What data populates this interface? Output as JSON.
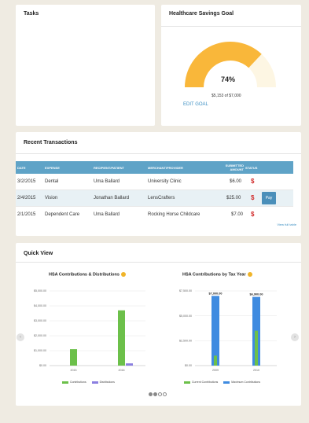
{
  "tasks": {
    "title": "Tasks"
  },
  "savings_goal": {
    "title": "Healthcare Savings Goal",
    "percent_text": "74%",
    "progress_fraction": 0.74,
    "amount_text": "$5,153 of $7,000",
    "edit_label": "EDIT GOAL"
  },
  "transactions": {
    "title": "Recent Transactions",
    "headers": {
      "date": "DATE",
      "expense": "EXPENSE",
      "recipient": "RECIPIENT/PATIENT",
      "merchant": "MERCHANT/PROVIDER",
      "amount_line1": "SUBMITTED",
      "amount_line2": "AMOUNT",
      "status": "STATUS"
    },
    "rows": [
      {
        "date": "3/2/2015",
        "expense": "Dental",
        "recipient": "Uma Ballard",
        "merchant": "University Clinic",
        "amount": "$6.00",
        "status": "$"
      },
      {
        "date": "2/4/2015",
        "expense": "Vision",
        "recipient": "Jonathan Ballard",
        "merchant": "LensCrafters",
        "amount": "$25.00",
        "status": "$",
        "action": "Pay"
      },
      {
        "date": "2/1/2015",
        "expense": "Dependent Care",
        "recipient": "Uma Ballard",
        "merchant": "Rocking Horse Childcare",
        "amount": "$7.00",
        "status": "$"
      }
    ],
    "view_all_label": "View full table"
  },
  "quick_view": {
    "title": "Quick View",
    "left_arrow": "‹",
    "right_arrow": "›"
  },
  "chart_data": [
    {
      "type": "bar",
      "title": "HSA Contributions & Distributions",
      "categories": [
        "2015",
        "2016"
      ],
      "series": [
        {
          "name": "Contributions",
          "color": "#6cc04a",
          "values": [
            1100,
            3700
          ]
        },
        {
          "name": "Distributions",
          "color": "#8b7fe0",
          "values": [
            0,
            150
          ]
        }
      ],
      "yticks": [
        "$0.00",
        "$1,000.00",
        "$2,000.00",
        "$3,000.00",
        "$4,000.00",
        "$5,000.00"
      ],
      "ylim": [
        0,
        5000
      ]
    },
    {
      "type": "bar",
      "title": "HSA Contributions by Tax Year",
      "categories": [
        "2009",
        "2010"
      ],
      "series": [
        {
          "name": "Current Contributions",
          "color": "#6cc04a",
          "values": [
            1000,
            3500
          ]
        },
        {
          "name": "Maximum Contributions",
          "color": "#3f8be0",
          "values": [
            7000,
            6900
          ]
        }
      ],
      "data_labels": [
        "$7,000.00",
        "$6,900.00"
      ],
      "yticks": [
        "$0.00",
        "$2,500.00",
        "$5,000.00",
        "$7,500.00"
      ],
      "ylim": [
        0,
        7500
      ]
    }
  ]
}
